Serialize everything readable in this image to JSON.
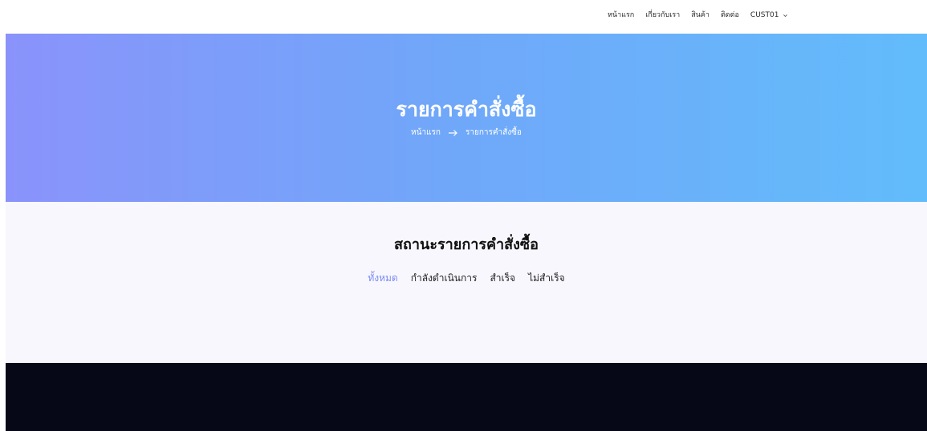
{
  "nav": {
    "items": [
      {
        "label": "หน้าแรก"
      },
      {
        "label": "เกี่ยวกับเรา"
      },
      {
        "label": "สินค้า"
      },
      {
        "label": "ติดต่อ"
      }
    ],
    "user": {
      "label": "CUST01",
      "icon": "chevron-down-icon"
    }
  },
  "hero": {
    "title": "รายการคำสั่งซื้อ",
    "breadcrumb": {
      "home": "หน้าแรก",
      "separator_icon": "arrow-right-icon",
      "current": "รายการคำสั่งซื้อ"
    },
    "gradient_start": "#8a93fb",
    "gradient_end": "#62bcfb"
  },
  "status": {
    "heading": "สถานะรายการคำสั่งซื้อ",
    "tabs": [
      {
        "label": "ทั้งหมด",
        "active": true
      },
      {
        "label": "กำลังดำเนินการ",
        "active": false
      },
      {
        "label": "สำเร็จ",
        "active": false
      },
      {
        "label": "ไม่สำเร็จ",
        "active": false
      }
    ],
    "active_color": "#7c8bf3"
  },
  "footer": {
    "background": "#060818"
  }
}
